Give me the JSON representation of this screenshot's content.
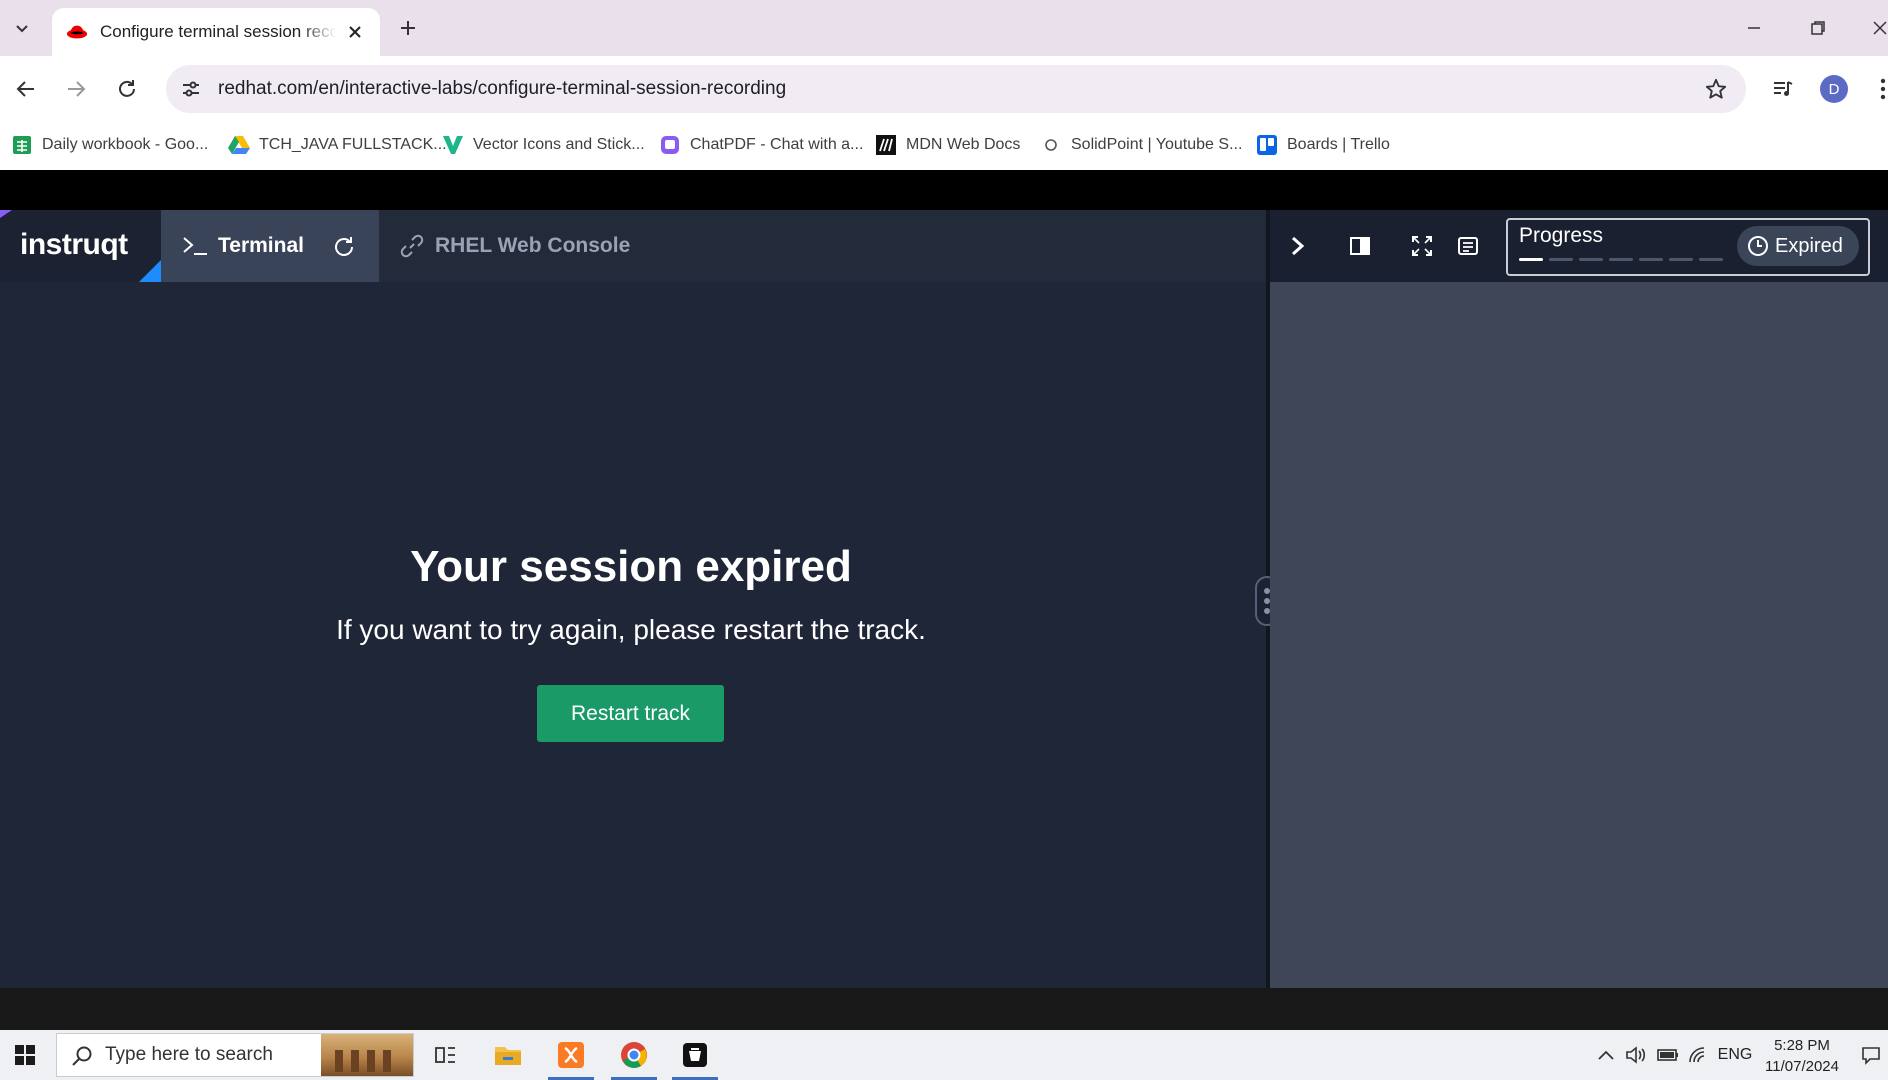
{
  "browser": {
    "tab_title": "Configure terminal session recording",
    "url": "redhat.com/en/interactive-labs/configure-terminal-session-recording",
    "profile_initial": "D",
    "bookmarks": [
      {
        "label": "Daily workbook - Goo...",
        "icon": "sheets-icon"
      },
      {
        "label": "TCH_JAVA FULLSTACK...",
        "icon": "drive-icon"
      },
      {
        "label": "Vector Icons and Stick...",
        "icon": "vector-icon"
      },
      {
        "label": "ChatPDF - Chat with a...",
        "icon": "chatpdf-icon"
      },
      {
        "label": "MDN Web Docs",
        "icon": "mdn-icon"
      },
      {
        "label": "SolidPoint | Youtube S...",
        "icon": "solidpoint-icon"
      },
      {
        "label": "Boards | Trello",
        "icon": "trello-icon"
      }
    ]
  },
  "app": {
    "logo": "instruqt",
    "tabs": [
      {
        "label": "Terminal",
        "active": true
      },
      {
        "label": "RHEL Web Console",
        "active": false
      }
    ],
    "session": {
      "title": "Your session expired",
      "subtitle": "If you want to try again, please restart the track.",
      "button": "Restart track"
    },
    "progress": {
      "label": "Progress",
      "status": "Expired",
      "steps_total": 7,
      "steps_done": 1
    }
  },
  "taskbar": {
    "search_placeholder": "Type here to search",
    "language": "ENG",
    "time": "5:28 PM",
    "date": "11/07/2024"
  },
  "colors": {
    "accent_button": "#1a9a66",
    "app_bg": "#1f2637",
    "side_panel_bg": "#3e4658"
  }
}
